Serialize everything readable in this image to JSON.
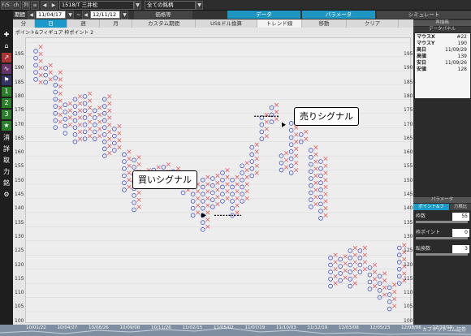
{
  "toolbar": {
    "mode_fixed": "F/S",
    "mode_chart": "ch",
    "mode_list": "列",
    "symbol": "1518/T 三井松",
    "list_selector": "全ての銘柄",
    "period_label": "期間",
    "date_from": "11/04/17",
    "date_to": "12/11/12",
    "dividend_label": "価格等",
    "top_tabs": [
      "データ",
      "パラメータ",
      "シミュレート"
    ]
  },
  "period_tabs": [
    "分",
    "日",
    "週",
    "月",
    "カスタム期間",
    "US$ドル換算",
    "トレンド線",
    "移動",
    "クリア"
  ],
  "chart": {
    "header": "ポイント&フィギュア 枠ポイント 2",
    "y_ticks": [
      "195",
      "190",
      "185",
      "180",
      "175",
      "170",
      "165",
      "160",
      "155",
      "150",
      "145",
      "140",
      "135",
      "130",
      "125",
      "120",
      "115",
      "110",
      "105",
      "100"
    ],
    "x_labels": [
      "10/01/22",
      "10/04/27",
      "10/06/26",
      "10/09/08",
      "10/11/26",
      "11/02/15",
      "11/05/02",
      "11/07/19",
      "11/10/03",
      "11/12/19",
      "12/03/08",
      "12/05/23",
      "12/08/06",
      "12/10/19"
    ],
    "x_boxes": [
      [
        1,
        181,
        194
      ],
      [
        2,
        182,
        188
      ],
      [
        3,
        167,
        185
      ],
      [
        4,
        166,
        175
      ],
      [
        5,
        161,
        177
      ],
      [
        6,
        162,
        179
      ],
      [
        7,
        162,
        173
      ],
      [
        8,
        156,
        176
      ],
      [
        9,
        158,
        166
      ],
      [
        10,
        144,
        157
      ],
      [
        11,
        137,
        156
      ],
      [
        12,
        150,
        150
      ],
      [
        13,
        151,
        152
      ],
      [
        14,
        147,
        152
      ],
      [
        15,
        148,
        151
      ],
      [
        16,
        143,
        148
      ],
      [
        17,
        135,
        147
      ],
      [
        18,
        130,
        148
      ],
      [
        19,
        138,
        149
      ],
      [
        20,
        140,
        151
      ],
      [
        21,
        135,
        149
      ],
      [
        22,
        140,
        153
      ],
      [
        23,
        149,
        161
      ],
      [
        24,
        162,
        171
      ],
      [
        25,
        168,
        175
      ],
      [
        26,
        151,
        157
      ],
      [
        27,
        150,
        168
      ],
      [
        28,
        161,
        165
      ],
      [
        29,
        138,
        160
      ],
      [
        30,
        134,
        156
      ],
      [
        31,
        110,
        121
      ],
      [
        32,
        112,
        121
      ],
      [
        33,
        110,
        123
      ],
      [
        34,
        115,
        123
      ],
      [
        35,
        109,
        117
      ],
      [
        36,
        106,
        114
      ],
      [
        37,
        102,
        110
      ],
      [
        38,
        111,
        124
      ]
    ],
    "o_boxes": [
      [
        1,
        182,
        194
      ],
      [
        2,
        181,
        188
      ],
      [
        3,
        165,
        184
      ],
      [
        4,
        163,
        174
      ],
      [
        5,
        160,
        176
      ],
      [
        6,
        161,
        178
      ],
      [
        7,
        161,
        172
      ],
      [
        8,
        155,
        175
      ],
      [
        9,
        157,
        165
      ],
      [
        10,
        143,
        156
      ],
      [
        11,
        136,
        155
      ],
      [
        12,
        149,
        149
      ],
      [
        13,
        150,
        151
      ],
      [
        14,
        146,
        151
      ],
      [
        15,
        147,
        150
      ],
      [
        16,
        142,
        147
      ],
      [
        17,
        134,
        146
      ],
      [
        18,
        129,
        147
      ],
      [
        19,
        137,
        148
      ],
      [
        20,
        139,
        150
      ],
      [
        21,
        134,
        148
      ],
      [
        22,
        139,
        152
      ],
      [
        23,
        148,
        160
      ],
      [
        24,
        161,
        170
      ],
      [
        25,
        167,
        174
      ],
      [
        26,
        150,
        156
      ],
      [
        27,
        149,
        167
      ],
      [
        28,
        160,
        164
      ],
      [
        29,
        137,
        159
      ],
      [
        30,
        133,
        155
      ],
      [
        31,
        109,
        120
      ],
      [
        32,
        111,
        120
      ],
      [
        33,
        109,
        122
      ],
      [
        34,
        114,
        122
      ],
      [
        35,
        108,
        116
      ],
      [
        36,
        105,
        113
      ],
      [
        37,
        101,
        109
      ],
      [
        38,
        110,
        123
      ]
    ],
    "buy_signal": "買いシグナル",
    "sell_signal": "売りシグナル"
  },
  "right_panel": {
    "title": "再描画",
    "section": "データパネル",
    "rows": [
      [
        "マウスX",
        "#22"
      ],
      [
        "マウスY",
        "190"
      ],
      [
        "高日",
        "11/09/29"
      ],
      [
        "高値",
        "139"
      ],
      [
        "安日",
        "11/09/26"
      ],
      [
        "安値",
        "128"
      ]
    ],
    "param_title": "パラメータ",
    "param_tabs": [
      "ポイント&フ",
      "力積比"
    ],
    "params": [
      [
        "枠数",
        "55"
      ],
      [
        "枠ポイント",
        "0"
      ],
      [
        "転換数",
        "3"
      ]
    ]
  },
  "brand": "カブドットコム証券",
  "colors": {
    "x_mark": "#e06060",
    "o_mark": "#4050c8",
    "accent": "#1b9ac9"
  }
}
